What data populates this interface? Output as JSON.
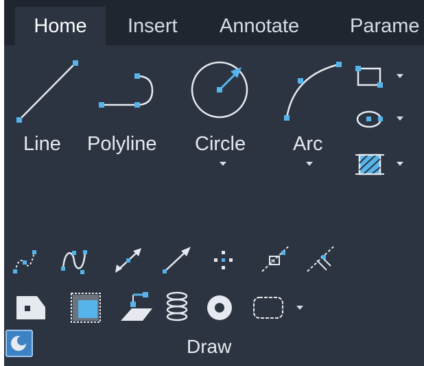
{
  "tabs": [
    {
      "label": "Home",
      "active": true
    },
    {
      "label": "Insert",
      "active": false
    },
    {
      "label": "Annotate",
      "active": false
    },
    {
      "label": "Parame",
      "active": false
    }
  ],
  "draw": {
    "big_tools": {
      "line": "Line",
      "polyline": "Polyline",
      "circle": "Circle",
      "arc": "Arc"
    },
    "panel_title": "Draw"
  },
  "colors": {
    "background": "#2b3440",
    "tabbar": "#1f2630",
    "accent": "#56b4ea",
    "stroke": "#e6eaf0"
  },
  "icons": [
    "rectangle-icon",
    "ellipse-icon",
    "hatch-icon",
    "spline-fit-icon",
    "spline-cv-icon",
    "construction-line-icon",
    "ray-icon",
    "multiple-points-icon",
    "divide-icon",
    "measure-icon",
    "region-icon",
    "gradient-icon",
    "boundary-icon",
    "helix-icon",
    "donut-icon",
    "revision-cloud-icon",
    "panel-settings-icon"
  ]
}
